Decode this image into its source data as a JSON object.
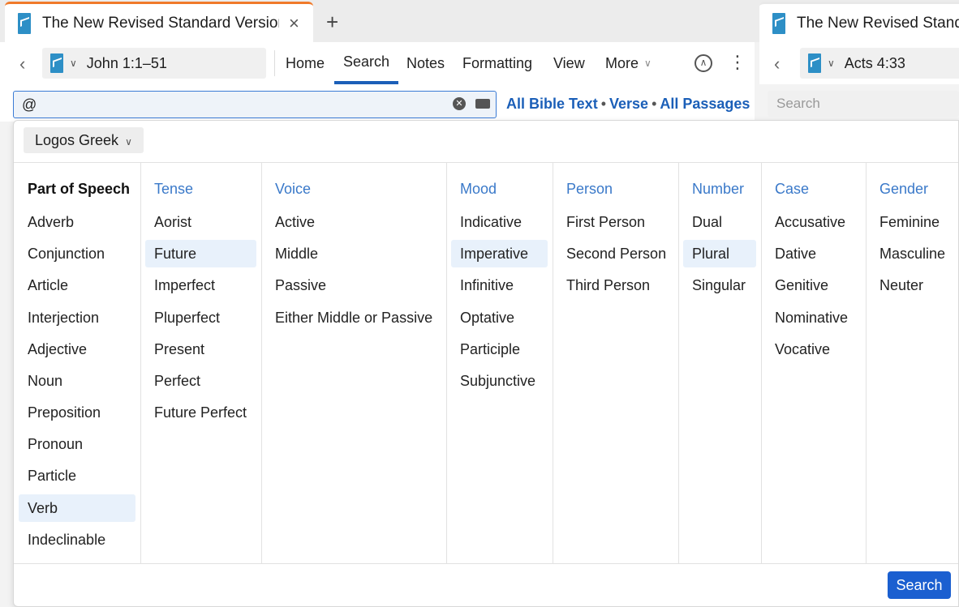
{
  "tabs": [
    {
      "title": "The New Revised Standard Version",
      "close": "×"
    },
    {
      "title": "The New Revised Standard Version"
    }
  ],
  "new_tab_label": "+",
  "left_pane": {
    "reference": "John 1:1–51",
    "nav": [
      "Home",
      "Search",
      "Notes",
      "Formatting",
      "View",
      "More"
    ],
    "active_nav": "Search",
    "search_value": "@",
    "scope": {
      "a": "All Bible Text",
      "b": "Verse",
      "c": "All Passages"
    }
  },
  "right_pane": {
    "reference": "Acts 4:33",
    "search_placeholder": "Search"
  },
  "morph": {
    "language": "Logos Greek",
    "columns": [
      {
        "head": "Part of Speech",
        "items": [
          "Adverb",
          "Conjunction",
          "Article",
          "Interjection",
          "Adjective",
          "Noun",
          "Preposition",
          "Pronoun",
          "Particle",
          "Verb",
          "Indeclinable"
        ],
        "selected": "Verb"
      },
      {
        "head": "Tense",
        "items": [
          "Aorist",
          "Future",
          "Imperfect",
          "Pluperfect",
          "Present",
          "Perfect",
          "Future Perfect"
        ],
        "selected": "Future"
      },
      {
        "head": "Voice",
        "items": [
          "Active",
          "Middle",
          "Passive",
          "Either Middle or Passive"
        ]
      },
      {
        "head": "Mood",
        "items": [
          "Indicative",
          "Imperative",
          "Infinitive",
          "Optative",
          "Participle",
          "Subjunctive"
        ],
        "selected": "Imperative"
      },
      {
        "head": "Person",
        "items": [
          "First Person",
          "Second Person",
          "Third Person"
        ]
      },
      {
        "head": "Number",
        "items": [
          "Dual",
          "Plural",
          "Singular"
        ],
        "selected": "Plural"
      },
      {
        "head": "Case",
        "items": [
          "Accusative",
          "Dative",
          "Genitive",
          "Nominative",
          "Vocative"
        ]
      },
      {
        "head": "Gender",
        "items": [
          "Feminine",
          "Masculine",
          "Neuter"
        ]
      }
    ],
    "search_button": "Search"
  },
  "colors": {
    "accent": "#1b5fb8",
    "tab_active": "#f07a2a",
    "selection": "#e8f1fb",
    "button": "#1b5fd0"
  }
}
